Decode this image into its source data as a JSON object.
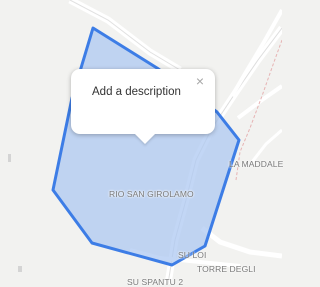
{
  "map": {
    "labels": {
      "district": "RIO SAN GIROLAMO",
      "la_maddalena": "LA MADDALE",
      "su_loi": "SU LOI",
      "torre_degli": "TORRE DEGLI",
      "su_spantu": "SU SPANTU 2"
    },
    "polygon": {
      "stroke_color": "#3d7de6",
      "fill_color": "#aec8f2"
    }
  },
  "popup": {
    "text": "Add a description",
    "close_icon": "close-icon"
  }
}
